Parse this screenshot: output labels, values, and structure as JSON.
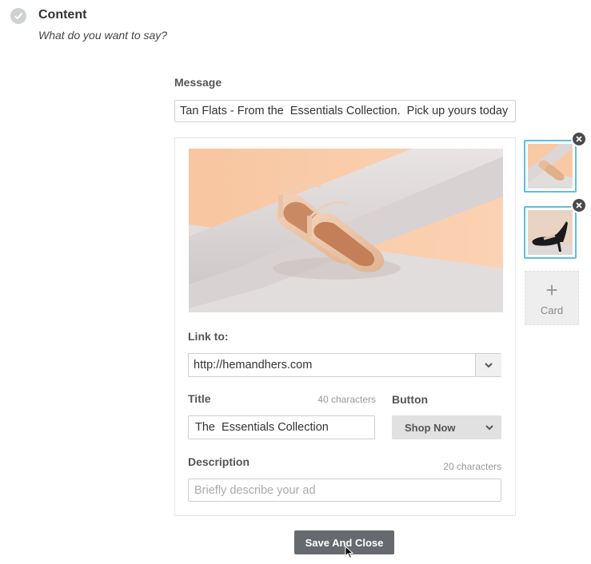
{
  "section": {
    "title": "Content",
    "subtitle": "What do you want to say?"
  },
  "message": {
    "label": "Message",
    "value": "Tan Flats - From the  Essentials Collection.  Pick up yours today"
  },
  "card": {
    "link": {
      "label": "Link to:",
      "value": "http://hemandhers.com"
    },
    "title": {
      "label": "Title",
      "count": "40 characters",
      "value": "The  Essentials Collection"
    },
    "button": {
      "label": "Button",
      "value": "Shop Now"
    },
    "description": {
      "label": "Description",
      "count": "20 characters",
      "placeholder": "Briefly describe your ad",
      "value": ""
    }
  },
  "thumbnails": [
    {
      "name": "tan-flats"
    },
    {
      "name": "black-heels"
    }
  ],
  "add_card": {
    "plus": "+",
    "label": "Card"
  },
  "save_button": "Save And Close",
  "colors": {
    "thumb_border": "#5bc0de",
    "save_button_bg": "#666a6e",
    "image_bg": "#f7c9a6"
  }
}
